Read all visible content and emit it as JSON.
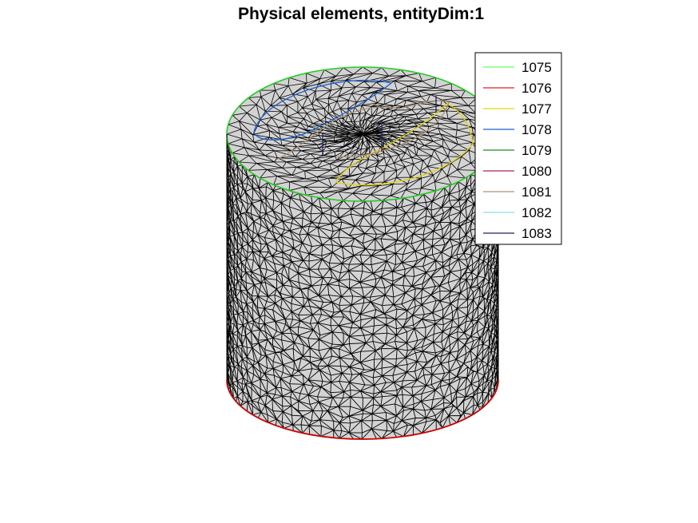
{
  "figure": {
    "title": "Physical elements, entityDim:1"
  },
  "legend": {
    "placement": "top-right",
    "entries": [
      {
        "label": "1075",
        "color": "#66ff66"
      },
      {
        "label": "1076",
        "color": "#dd2222"
      },
      {
        "label": "1077",
        "color": "#e6d200"
      },
      {
        "label": "1078",
        "color": "#1a5fd0"
      },
      {
        "label": "1079",
        "color": "#1e8a1e"
      },
      {
        "label": "1080",
        "color": "#b0204a"
      },
      {
        "label": "1081",
        "color": "#b09070"
      },
      {
        "label": "1082",
        "color": "#88ddee"
      },
      {
        "label": "1083",
        "color": "#202060"
      }
    ]
  },
  "mesh": {
    "shape": "cylinder",
    "fill_color": "#d3d3d3",
    "edge_color": "#000000",
    "top_rim_color": "#22cc22",
    "bottom_rim_color": "#cc0000"
  }
}
